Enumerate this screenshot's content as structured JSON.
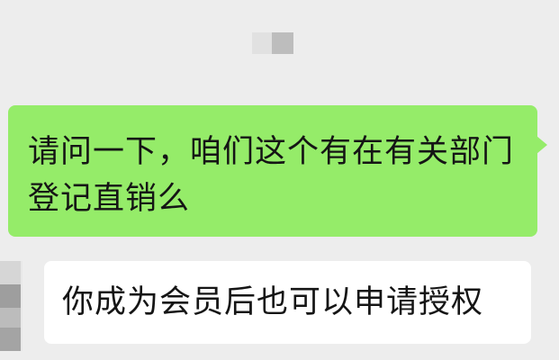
{
  "colors": {
    "background": "#ededed",
    "outgoing_bubble": "#95ec69",
    "incoming_bubble": "#ffffff",
    "text": "#151515"
  },
  "messages": [
    {
      "direction": "outgoing",
      "text": "请问一下，咱们这个有在有关部门登记直销么"
    },
    {
      "direction": "incoming",
      "text": "你成为会员后也可以申请授权"
    }
  ]
}
